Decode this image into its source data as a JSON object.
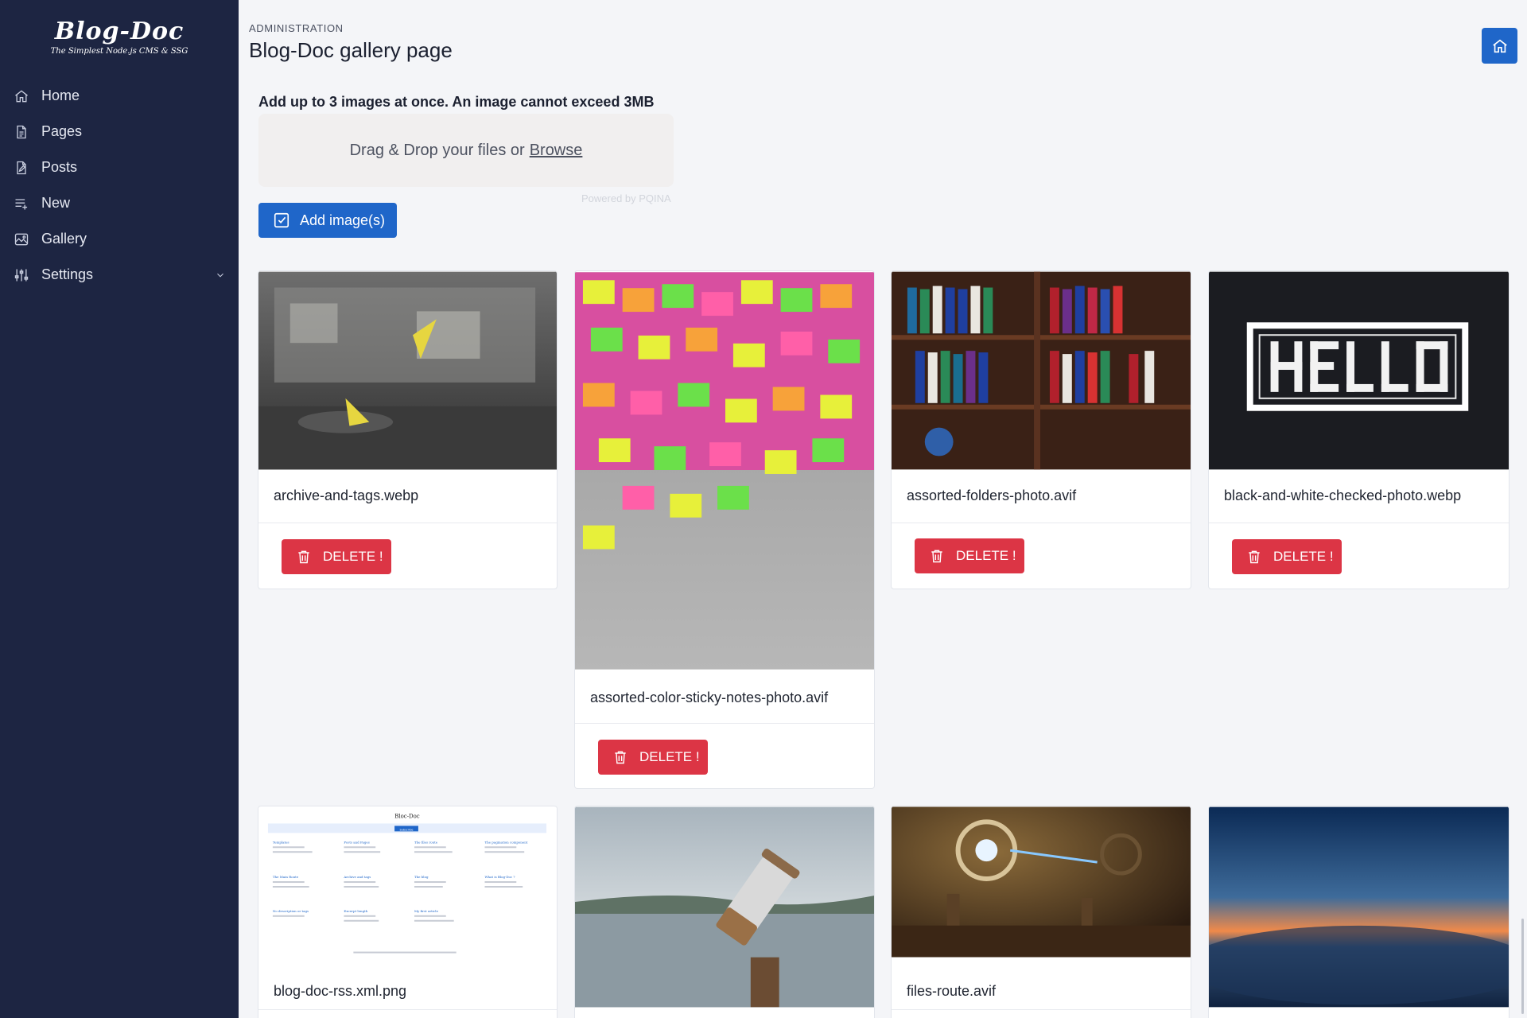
{
  "brand": {
    "name": "Blog-Doc",
    "tagline": "The Simplest Node.js CMS & SSG"
  },
  "sidebar": {
    "items": [
      {
        "label": "Home",
        "icon": "home-icon"
      },
      {
        "label": "Pages",
        "icon": "document-icon"
      },
      {
        "label": "Posts",
        "icon": "edit-document-icon"
      },
      {
        "label": "New",
        "icon": "list-add-icon"
      },
      {
        "label": "Gallery",
        "icon": "image-icon"
      },
      {
        "label": "Settings",
        "icon": "sliders-icon",
        "has_submenu": true
      }
    ]
  },
  "header": {
    "eyebrow": "ADMINISTRATION",
    "title": "Blog-Doc gallery page",
    "home_button_icon": "home-icon"
  },
  "upload": {
    "label": "Add up to 3 images at once. An image cannot exceed 3MB",
    "dropzone_text": "Drag & Drop your files or",
    "browse_label": "Browse",
    "powered_by": "Powered by PQINA",
    "add_button_label": "Add image(s)"
  },
  "gallery": {
    "delete_label": "DELETE !",
    "images": [
      {
        "filename": "archive-and-tags.webp"
      },
      {
        "filename": "assorted-color-sticky-notes-photo.avif"
      },
      {
        "filename": "assorted-folders-photo.avif"
      },
      {
        "filename": "black-and-white-checked-photo.webp"
      },
      {
        "filename": "blog-doc-rss.xml.png"
      },
      {
        "filename": ""
      },
      {
        "filename": "files-route.avif"
      },
      {
        "filename": ""
      }
    ]
  },
  "thumb_preview": {
    "site_title": "Bloc-Doc",
    "button": "Subscribe",
    "posts": [
      "Templates",
      "Posts and Pages",
      "The files route",
      "The pagination component",
      "The Main Route",
      "Archive and tags",
      "The blog",
      "What is Blog-Doc ?",
      "No description or tags",
      "Excerpt length",
      "My first article"
    ]
  },
  "colors": {
    "sidebar_bg": "#1d2542",
    "primary": "#1f66c9",
    "danger": "#dc3545"
  }
}
